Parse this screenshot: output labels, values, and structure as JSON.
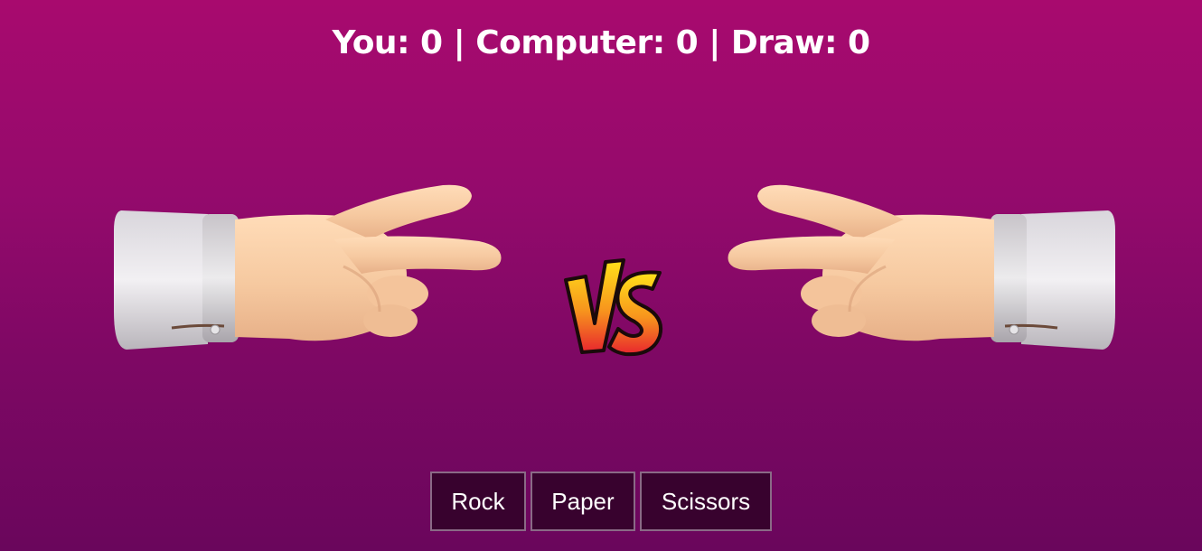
{
  "scoreboard": {
    "text": "You: 0 | Computer: 0 | Draw: 0",
    "you": 0,
    "computer": 0,
    "draw": 0
  },
  "player_hand": "scissors-hand-icon",
  "computer_hand": "scissors-hand-icon",
  "versus_icon": "vs-badge-icon",
  "buttons": {
    "rock": "Rock",
    "paper": "Paper",
    "scissors": "Scissors"
  },
  "colors": {
    "background_top": "#a80a6e",
    "background_bottom": "#6a065c",
    "button_bg": "#38022e",
    "button_border": "#8a6a86",
    "vs_yellow": "#ffe21a",
    "vs_red": "#e8262e"
  }
}
